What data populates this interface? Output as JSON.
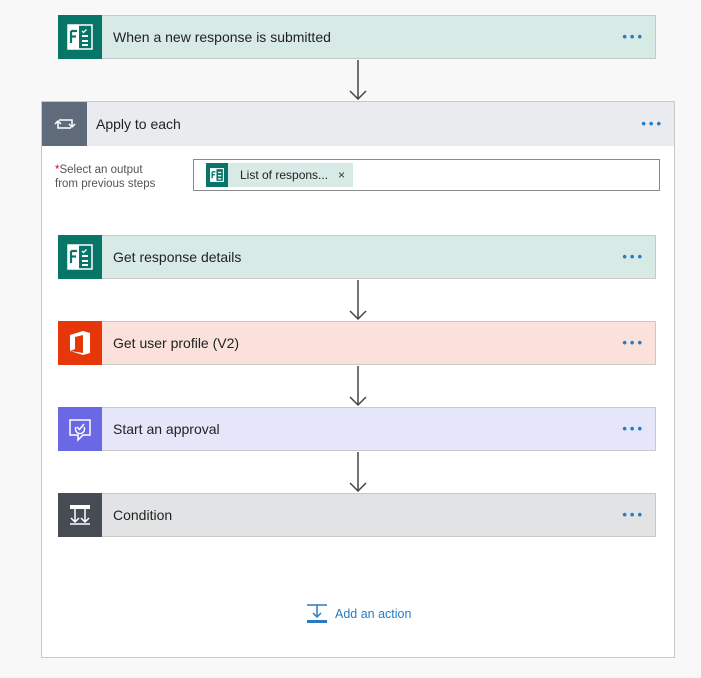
{
  "trigger": {
    "title": "When a new response is submitted",
    "more": "•••"
  },
  "apply": {
    "title": "Apply to each",
    "more": "•••",
    "select": {
      "required_mark": "*",
      "label_line1": "Select an output",
      "label_line2": "from previous steps",
      "token_label": "List of respons...",
      "token_close": "×"
    }
  },
  "actions": [
    {
      "title": "Get response details",
      "more": "•••",
      "icon": "forms-icon"
    },
    {
      "title": "Get user profile (V2)",
      "more": "•••",
      "icon": "office-icon"
    },
    {
      "title": "Start an approval",
      "more": "•••",
      "icon": "approval-icon"
    },
    {
      "title": "Condition",
      "more": "•••",
      "icon": "condition-icon"
    }
  ],
  "add_action": {
    "label": "Add an action"
  },
  "colors": {
    "forms": "#077568",
    "forms_bg": "#d8eae6",
    "office": "#e5370a",
    "office_bg": "#fbe1db",
    "approval": "#6b68e5",
    "approval_bg": "#e5e6fa",
    "condition": "#474c54",
    "condition_bg": "#e2e3e4",
    "link": "#2b7bc0"
  }
}
